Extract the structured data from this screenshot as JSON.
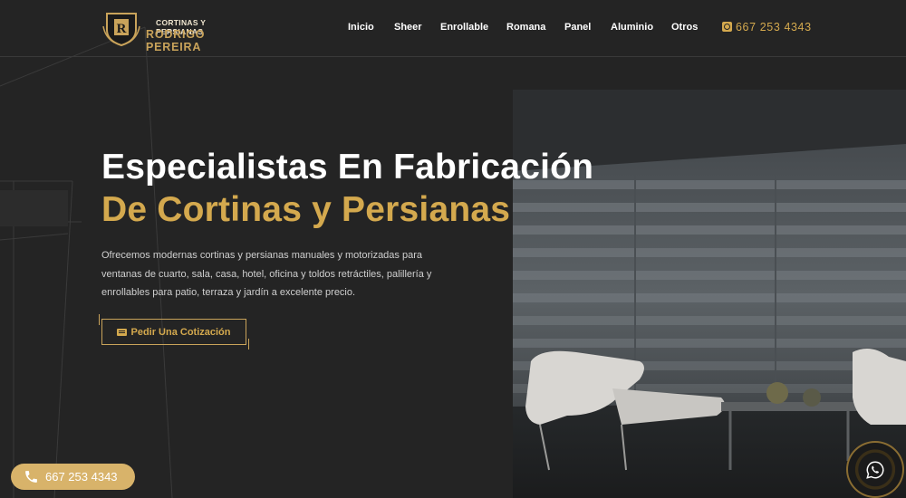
{
  "header": {
    "logo": {
      "top_text": "CORTINAS Y PERSIANAS",
      "bottom_text": "RODRIGO PEREIRA",
      "emblem_letter": "R"
    },
    "nav": [
      {
        "label": "Inicio"
      },
      {
        "label": "Sheer"
      },
      {
        "label": "Enrollable"
      },
      {
        "label": "Romana"
      },
      {
        "label": "Panel"
      },
      {
        "label": "Aluminio"
      },
      {
        "label": "Otros"
      }
    ],
    "phone": "667 253 4343"
  },
  "hero": {
    "title_line1": "Especialistas En Fabricación",
    "title_line2": "De Cortinas y Persianas",
    "description": "Ofrecemos modernas cortinas y persianas manuales y motorizadas para ventanas de cuarto, sala, casa, hotel, oficina y toldos retráctiles, palillería y enrollables para patio, terraza y jardín a excelente precio.",
    "cta_label": "Pedir Una Cotización"
  },
  "floating": {
    "phone_label": "667 253 4343"
  },
  "colors": {
    "background": "#242424",
    "accent_gold": "#d4a94e",
    "float_button": "#d8b36a"
  },
  "icons": {
    "phone_nav": "whatsapp-icon",
    "cta": "id-card-icon",
    "float_phone": "phone-icon",
    "float_wa": "whatsapp-icon"
  }
}
